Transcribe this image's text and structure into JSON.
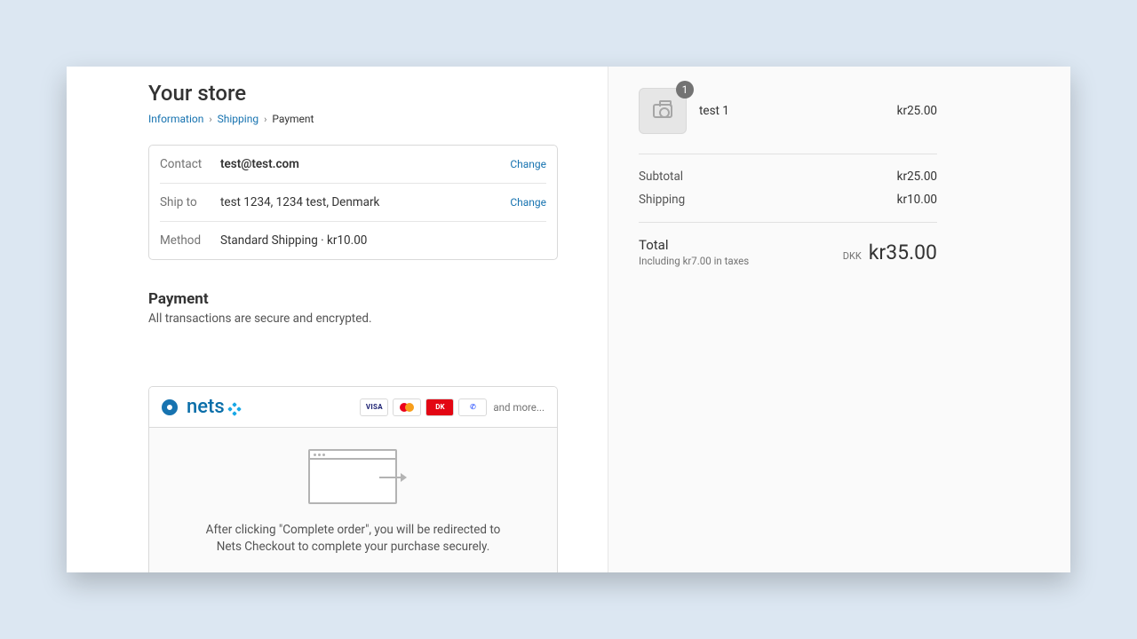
{
  "store": {
    "name": "Your store"
  },
  "breadcrumb": {
    "information": "Information",
    "shipping": "Shipping",
    "payment": "Payment"
  },
  "review": {
    "contact_label": "Contact",
    "contact_value": "test@test.com",
    "shipto_label": "Ship to",
    "shipto_value": "test 1234, 1234 test, Denmark",
    "method_label": "Method",
    "method_value": "Standard Shipping · kr10.00",
    "change": "Change"
  },
  "payment": {
    "heading": "Payment",
    "sub": "All transactions are secure and encrypted.",
    "provider": "nets",
    "more": "and more...",
    "redirect_text": "After clicking \"Complete order\", you will be redirected to Nets Checkout to complete your purchase securely."
  },
  "cart": {
    "item": {
      "name": "test 1",
      "qty": "1",
      "price": "kr25.00"
    },
    "subtotal_label": "Subtotal",
    "subtotal_value": "kr25.00",
    "shipping_label": "Shipping",
    "shipping_value": "kr10.00",
    "total_label": "Total",
    "tax_note": "Including kr7.00 in taxes",
    "currency": "DKK",
    "total_value": "kr35.00"
  }
}
